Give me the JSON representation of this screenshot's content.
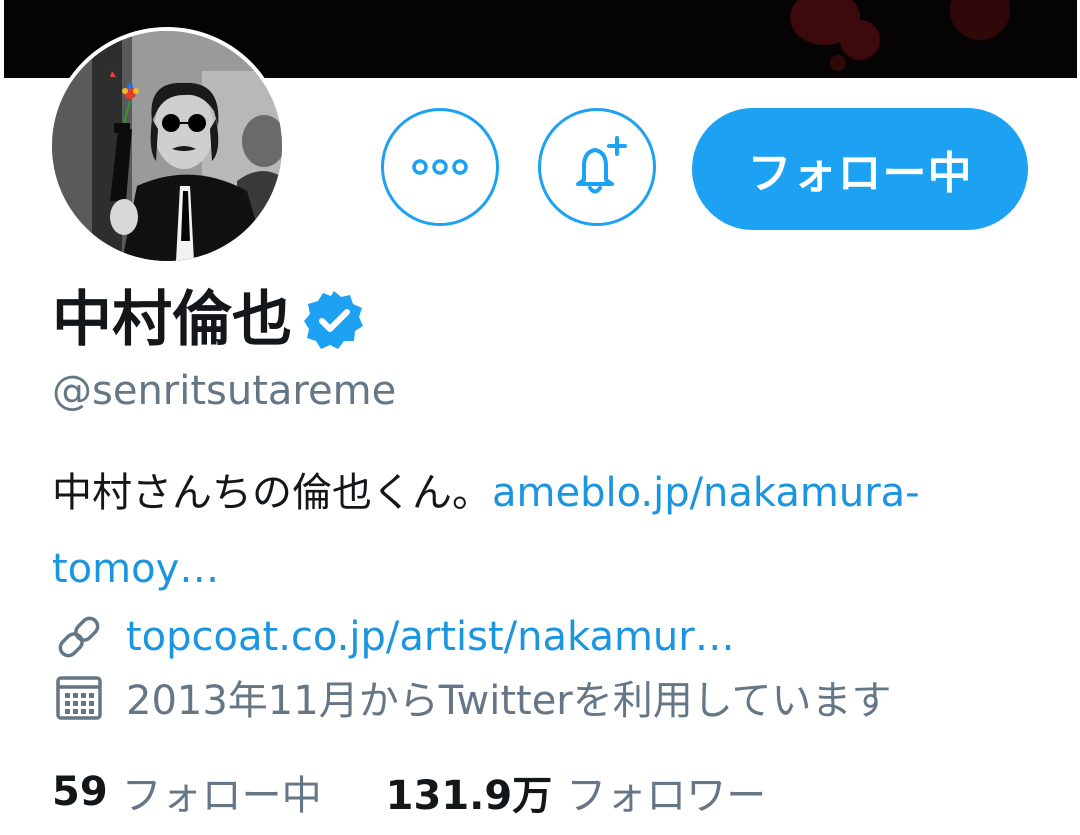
{
  "profile": {
    "display_name": "中村倫也",
    "handle": "@senritsutareme",
    "verified": true,
    "bio_text": "中村さんちの倫也くん。",
    "bio_link_line1": "ameblo.jp/nakamura-",
    "bio_link_line2": "tomoy…",
    "website": "topcoat.co.jp/artist/nakamur…",
    "joined": "2013年11月からTwitterを利用しています"
  },
  "actions": {
    "more_icon": "more-dots-icon",
    "notify_icon": "bell-plus-icon",
    "follow_label": "フォロー中"
  },
  "stats": {
    "following_count": "59",
    "following_label": "フォロー中",
    "followers_count": "131.9万",
    "followers_label": "フォロワー"
  },
  "colors": {
    "accent": "#1da1f2",
    "link": "#1b95e0",
    "muted": "#657786",
    "text": "#14171a"
  }
}
